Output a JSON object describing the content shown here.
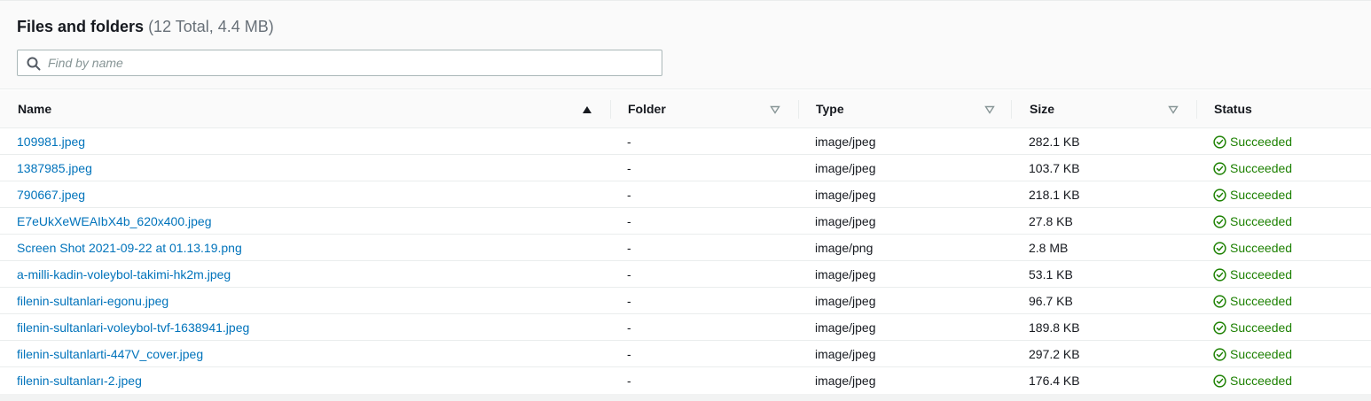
{
  "header": {
    "title": "Files and folders",
    "counter": "(12 Total, 4.4 MB)"
  },
  "search": {
    "placeholder": "Find by name",
    "value": ""
  },
  "columns": [
    {
      "label": "Name",
      "sort": "ascending"
    },
    {
      "label": "Folder",
      "sort": "none"
    },
    {
      "label": "Type",
      "sort": "none"
    },
    {
      "label": "Size",
      "sort": "none"
    },
    {
      "label": "Status"
    }
  ],
  "rows": [
    {
      "name": "109981.jpeg",
      "folder": "-",
      "type": "image/jpeg",
      "size": "282.1 KB",
      "status": "Succeeded"
    },
    {
      "name": "1387985.jpeg",
      "folder": "-",
      "type": "image/jpeg",
      "size": "103.7 KB",
      "status": "Succeeded"
    },
    {
      "name": "790667.jpeg",
      "folder": "-",
      "type": "image/jpeg",
      "size": "218.1 KB",
      "status": "Succeeded"
    },
    {
      "name": "E7eUkXeWEAIbX4b_620x400.jpeg",
      "folder": "-",
      "type": "image/jpeg",
      "size": "27.8 KB",
      "status": "Succeeded"
    },
    {
      "name": "Screen Shot 2021-09-22 at 01.13.19.png",
      "folder": "-",
      "type": "image/png",
      "size": "2.8 MB",
      "status": "Succeeded"
    },
    {
      "name": "a-milli-kadin-voleybol-takimi-hk2m.jpeg",
      "folder": "-",
      "type": "image/jpeg",
      "size": "53.1 KB",
      "status": "Succeeded"
    },
    {
      "name": "filenin-sultanlari-egonu.jpeg",
      "folder": "-",
      "type": "image/jpeg",
      "size": "96.7 KB",
      "status": "Succeeded"
    },
    {
      "name": "filenin-sultanlari-voleybol-tvf-1638941.jpeg",
      "folder": "-",
      "type": "image/jpeg",
      "size": "189.8 KB",
      "status": "Succeeded"
    },
    {
      "name": "filenin-sultanlarti-447V_cover.jpeg",
      "folder": "-",
      "type": "image/jpeg",
      "size": "297.2 KB",
      "status": "Succeeded"
    },
    {
      "name": "filenin-sultanları-2.jpeg",
      "folder": "-",
      "type": "image/jpeg",
      "size": "176.4 KB",
      "status": "Succeeded"
    }
  ],
  "colors": {
    "link": "#0073bb",
    "success": "#1d8102",
    "header_bg": "#fafafa",
    "border": "#eaeded"
  },
  "icons": {
    "search": "search-icon",
    "sort_active": "sort-ascending-icon",
    "sort_inactive": "sort-descending-outline-icon",
    "status": "status-success-icon"
  }
}
